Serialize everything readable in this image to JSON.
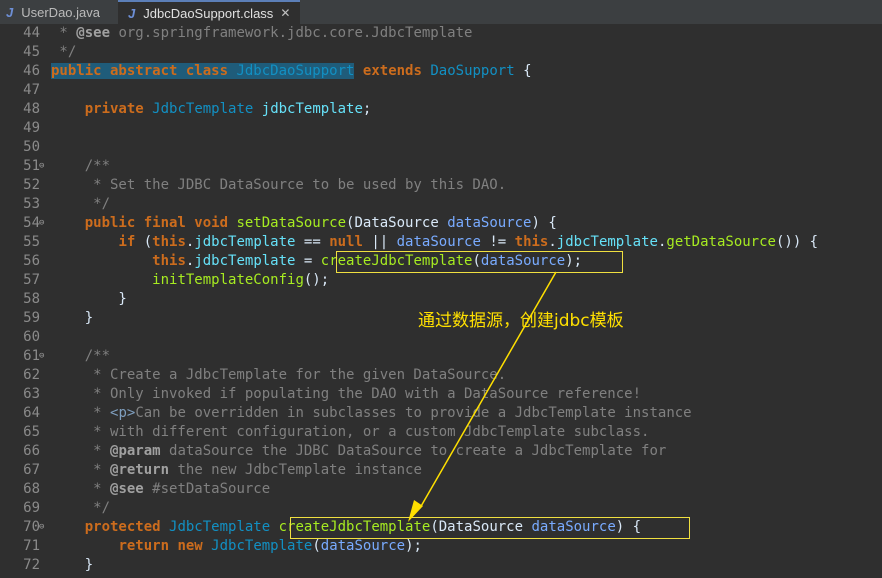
{
  "tabs": [
    {
      "label": "UserDao.java",
      "icon": "java-file-icon",
      "active": false
    },
    {
      "label": "JdbcDaoSupport.class",
      "icon": "java-file-icon",
      "active": true,
      "close": "✕"
    }
  ],
  "lines": [
    {
      "n": "44",
      "fold": "",
      "t": [
        [
          "cm",
          " * "
        ],
        [
          "ann",
          "@see"
        ],
        [
          "cm",
          " org.springframework.jdbc.core.JdbcTemplate"
        ]
      ]
    },
    {
      "n": "45",
      "fold": "",
      "t": [
        [
          "cm",
          " */"
        ]
      ]
    },
    {
      "n": "46",
      "fold": "",
      "t": [
        [
          "kw hl",
          "public abstract class"
        ],
        [
          "hl",
          " "
        ],
        [
          "ty hl",
          "JdbcDaoSupport"
        ],
        [
          "",
          " "
        ],
        [
          "kw",
          "extends"
        ],
        [
          "",
          " "
        ],
        [
          "ty",
          "DaoSupport"
        ],
        [
          "",
          " {"
        ]
      ]
    },
    {
      "n": "47",
      "fold": "",
      "t": []
    },
    {
      "n": "48",
      "fold": "",
      "t": [
        [
          "",
          "    "
        ],
        [
          "kw",
          "private"
        ],
        [
          "",
          " "
        ],
        [
          "ty",
          "JdbcTemplate"
        ],
        [
          "",
          " "
        ],
        [
          "var",
          "jdbcTemplate"
        ],
        [
          "",
          ";"
        ]
      ]
    },
    {
      "n": "49",
      "fold": "",
      "t": []
    },
    {
      "n": "50",
      "fold": "",
      "t": []
    },
    {
      "n": "51",
      "fold": "⊖",
      "t": [
        [
          "cm",
          "    /**"
        ]
      ]
    },
    {
      "n": "52",
      "fold": "",
      "t": [
        [
          "cm",
          "     * Set the JDBC DataSource to be used by this DAO."
        ]
      ]
    },
    {
      "n": "53",
      "fold": "",
      "t": [
        [
          "cm",
          "     */"
        ]
      ]
    },
    {
      "n": "54",
      "fold": "⊖",
      "t": [
        [
          "",
          "    "
        ],
        [
          "kw",
          "public final void"
        ],
        [
          "",
          " "
        ],
        [
          "meth",
          "setDataSource"
        ],
        [
          "",
          "(DataSource "
        ],
        [
          "param",
          "dataSource"
        ],
        [
          "",
          ") {"
        ]
      ]
    },
    {
      "n": "55",
      "fold": "",
      "t": [
        [
          "",
          "        "
        ],
        [
          "kw",
          "if"
        ],
        [
          "",
          " ("
        ],
        [
          "kw",
          "this"
        ],
        [
          "",
          "."
        ],
        [
          "var",
          "jdbcTemplate"
        ],
        [
          "",
          " == "
        ],
        [
          "kw",
          "null"
        ],
        [
          "",
          " || "
        ],
        [
          "param",
          "dataSource"
        ],
        [
          "",
          " != "
        ],
        [
          "kw",
          "this"
        ],
        [
          "",
          "."
        ],
        [
          "var",
          "jdbcTemplate"
        ],
        [
          "",
          "."
        ],
        [
          "meth",
          "getDataSource"
        ],
        [
          "",
          "()) {"
        ]
      ]
    },
    {
      "n": "56",
      "fold": "",
      "t": [
        [
          "",
          "            "
        ],
        [
          "kw",
          "this"
        ],
        [
          "",
          "."
        ],
        [
          "var",
          "jdbcTemplate"
        ],
        [
          "",
          " = "
        ],
        [
          "meth",
          "createJdbcTemplate"
        ],
        [
          "",
          "("
        ],
        [
          "param",
          "dataSource"
        ],
        [
          "",
          ");"
        ]
      ]
    },
    {
      "n": "57",
      "fold": "",
      "t": [
        [
          "",
          "            "
        ],
        [
          "meth",
          "initTemplateConfig"
        ],
        [
          "",
          "();"
        ]
      ]
    },
    {
      "n": "58",
      "fold": "",
      "t": [
        [
          "",
          "        }"
        ]
      ]
    },
    {
      "n": "59",
      "fold": "",
      "t": [
        [
          "",
          "    }"
        ]
      ]
    },
    {
      "n": "60",
      "fold": "",
      "t": []
    },
    {
      "n": "61",
      "fold": "⊖",
      "t": [
        [
          "cm",
          "    /**"
        ]
      ]
    },
    {
      "n": "62",
      "fold": "",
      "t": [
        [
          "cm",
          "     * Create a JdbcTemplate for the given DataSource."
        ]
      ]
    },
    {
      "n": "63",
      "fold": "",
      "t": [
        [
          "cm",
          "     * Only invoked if populating the DAO with a DataSource reference!"
        ]
      ]
    },
    {
      "n": "64",
      "fold": "",
      "t": [
        [
          "cm",
          "     * "
        ],
        [
          "tag",
          "<p>"
        ],
        [
          "cm",
          "Can be overridden in subclasses to provide a JdbcTemplate instance"
        ]
      ]
    },
    {
      "n": "65",
      "fold": "",
      "t": [
        [
          "cm",
          "     * with different configuration, or a custom JdbcTemplate subclass."
        ]
      ]
    },
    {
      "n": "66",
      "fold": "",
      "t": [
        [
          "cm",
          "     * "
        ],
        [
          "ann",
          "@param"
        ],
        [
          "cm",
          " dataSource the JDBC DataSource to create a JdbcTemplate for"
        ]
      ]
    },
    {
      "n": "67",
      "fold": "",
      "t": [
        [
          "cm",
          "     * "
        ],
        [
          "ann",
          "@return"
        ],
        [
          "cm",
          " the new JdbcTemplate instance"
        ]
      ]
    },
    {
      "n": "68",
      "fold": "",
      "t": [
        [
          "cm",
          "     * "
        ],
        [
          "ann",
          "@see"
        ],
        [
          "cm",
          " #setDataSource"
        ]
      ]
    },
    {
      "n": "69",
      "fold": "",
      "t": [
        [
          "cm",
          "     */"
        ]
      ]
    },
    {
      "n": "70",
      "fold": "⊖",
      "t": [
        [
          "",
          "    "
        ],
        [
          "kw",
          "protected"
        ],
        [
          "",
          " "
        ],
        [
          "ty",
          "JdbcTemplate"
        ],
        [
          "",
          " "
        ],
        [
          "meth",
          "createJdbcTemplate"
        ],
        [
          "",
          "(DataSource "
        ],
        [
          "param",
          "dataSource"
        ],
        [
          "",
          ") {"
        ]
      ]
    },
    {
      "n": "71",
      "fold": "",
      "t": [
        [
          "",
          "        "
        ],
        [
          "kw",
          "return new"
        ],
        [
          "",
          " "
        ],
        [
          "ty",
          "JdbcTemplate"
        ],
        [
          "",
          "("
        ],
        [
          "param",
          "dataSource"
        ],
        [
          "",
          ");"
        ]
      ]
    },
    {
      "n": "72",
      "fold": "",
      "t": [
        [
          "",
          "    }"
        ]
      ]
    }
  ],
  "annotation": {
    "text": "通过数据源，创建jdbc模板",
    "color": "#ffe000"
  }
}
